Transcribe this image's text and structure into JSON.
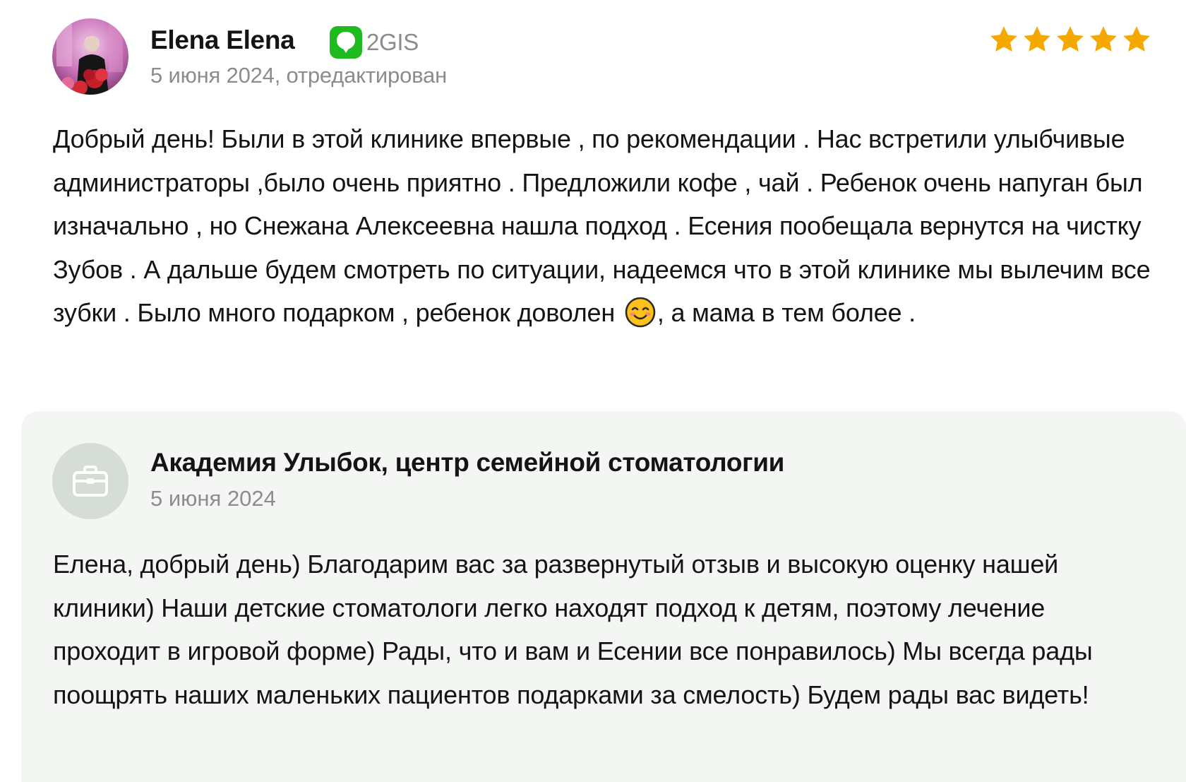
{
  "review": {
    "author_name": "Elena Elena",
    "avatar_icon": "user-photo-avatar",
    "source": {
      "label": "2GIS",
      "icon": "2gis-logo-icon",
      "color": "#1fba1f"
    },
    "date": "5 июня 2024, отредактирован",
    "rating": 5,
    "rating_max": 5,
    "star_color": "#f5a800",
    "text_before_emoji": "Добрый день! Были в этой клинике впервые , по рекомендации . Нас встретили улыбчивые администраторы ,было очень приятно . Предложили кофе , чай . Ребенок очень напуган был изначально , но Снежана Алексеевна нашла подход . Есения пообещала вернутся на чистку Зубов . А дальше будем смотреть по ситуации, надеемся что в этой клинике мы вылечим все зубки . Было много подарком , ребенок доволен",
    "emoji": "smiling-face-emoji",
    "text_after_emoji": ", а мама в тем более ."
  },
  "response": {
    "company_name": "Академия Улыбок, центр семейной стоматологии",
    "avatar_icon": "briefcase-icon",
    "date": "5 июня 2024",
    "text": "Елена, добрый день) Благодарим вас за развернутый отзыв и высокую оценку нашей клиники) Наши детские стоматологи легко находят подход к детям, поэтому лечение проходит в игровой форме) Рады, что и вам и Есении все понравилось) Мы всегда рады поощрять наших маленьких пациентов подарками за смелость) Будем рады вас видеть!",
    "background_color": "#f4f6f4"
  }
}
